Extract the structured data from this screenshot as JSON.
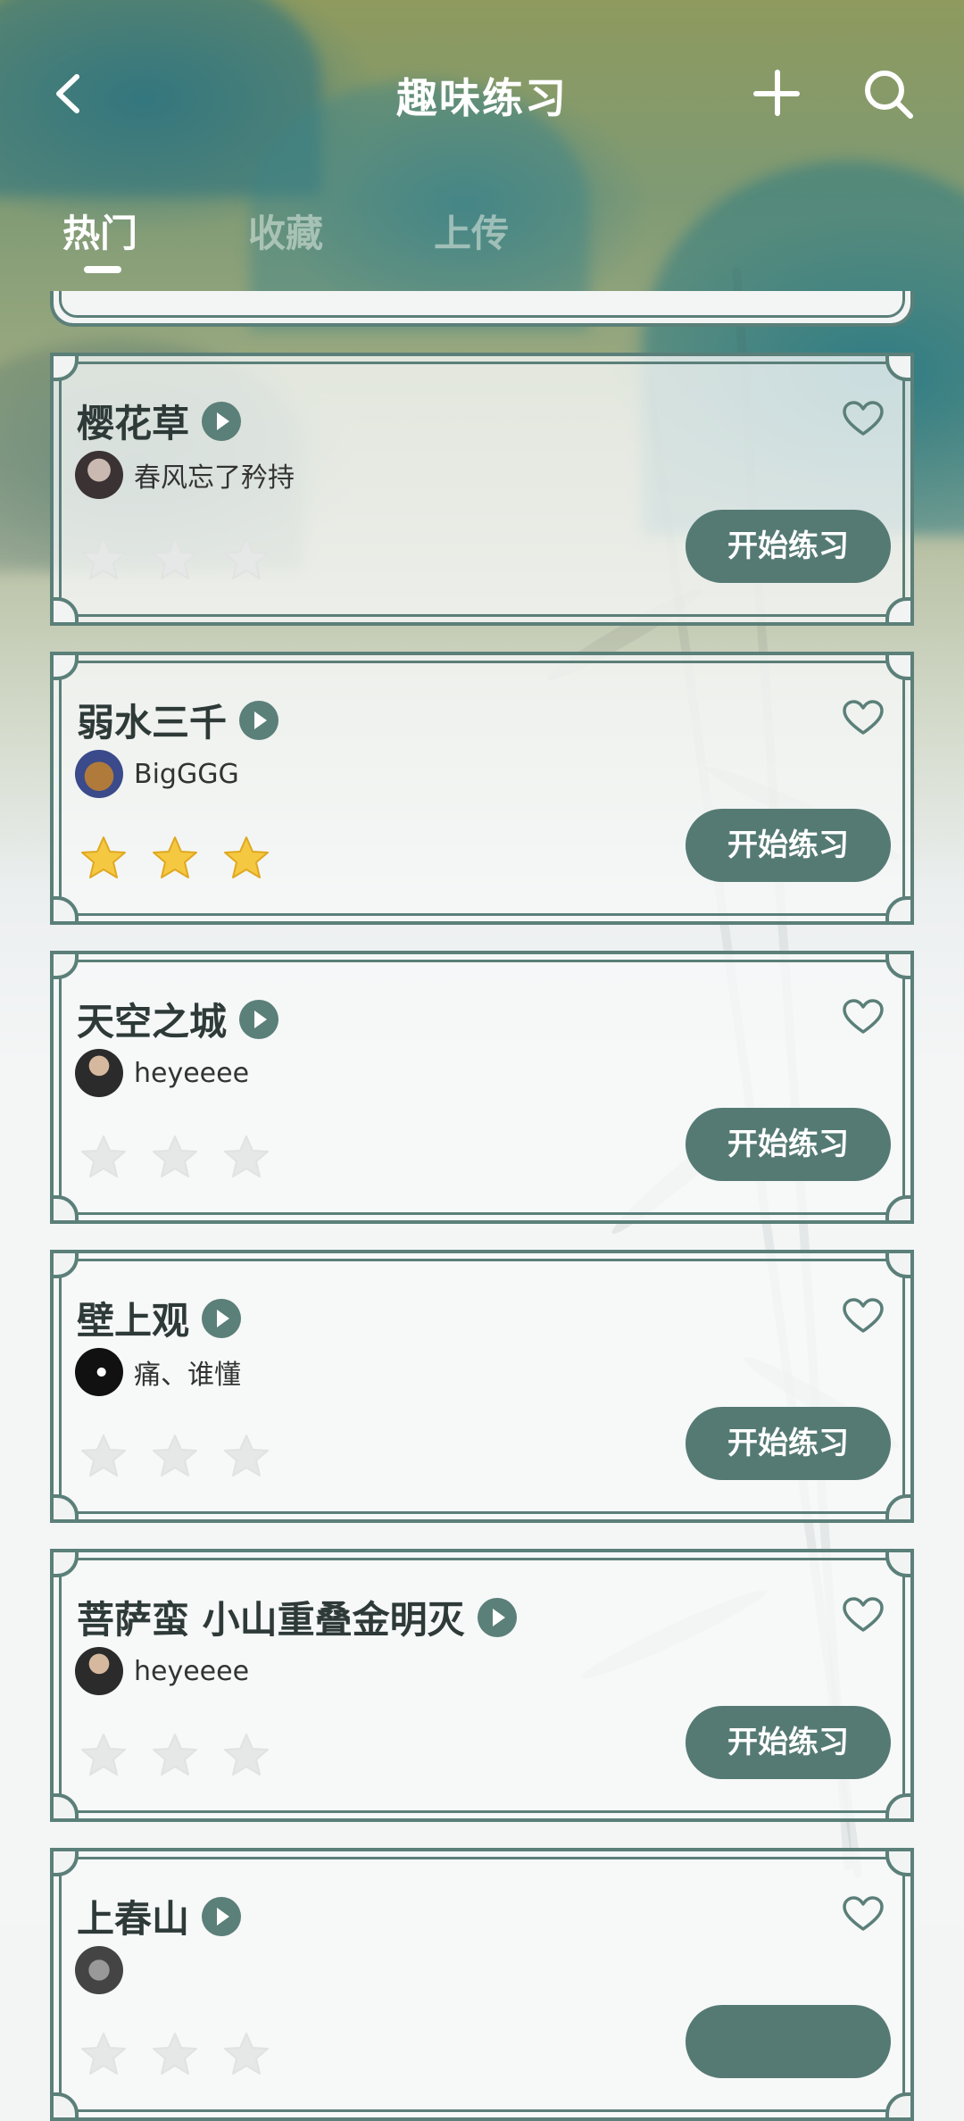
{
  "header": {
    "title": "趣味练习",
    "back_icon": "back-chevron-icon",
    "add_icon": "plus-icon",
    "search_icon": "search-icon"
  },
  "tabs": [
    {
      "label": "热门",
      "active": true
    },
    {
      "label": "收藏",
      "active": false
    },
    {
      "label": "上传",
      "active": false
    }
  ],
  "colors": {
    "accent": "#557a74",
    "frame": "#5b7f79",
    "star_filled": "#f5c842",
    "star_empty": "#e6e8e7"
  },
  "items": [
    {
      "title": "樱花草",
      "author": "春风忘了矜持",
      "stars_filled": 0,
      "stars_total": 3,
      "button": "开始练习"
    },
    {
      "title": "弱水三千",
      "author": "BigGGG",
      "stars_filled": 3,
      "stars_total": 3,
      "button": "开始练习"
    },
    {
      "title": "天空之城",
      "author": "heyeeee",
      "stars_filled": 0,
      "stars_total": 3,
      "button": "开始练习"
    },
    {
      "title": "壁上观",
      "author": "痛、谁懂",
      "stars_filled": 0,
      "stars_total": 3,
      "button": "开始练习"
    },
    {
      "title": "菩萨蛮 小山重叠金明灭",
      "author": "heyeeee",
      "stars_filled": 0,
      "stars_total": 3,
      "button": "开始练习"
    },
    {
      "title": "上春山",
      "author": "",
      "stars_filled": 0,
      "stars_total": 3,
      "button": ""
    }
  ]
}
